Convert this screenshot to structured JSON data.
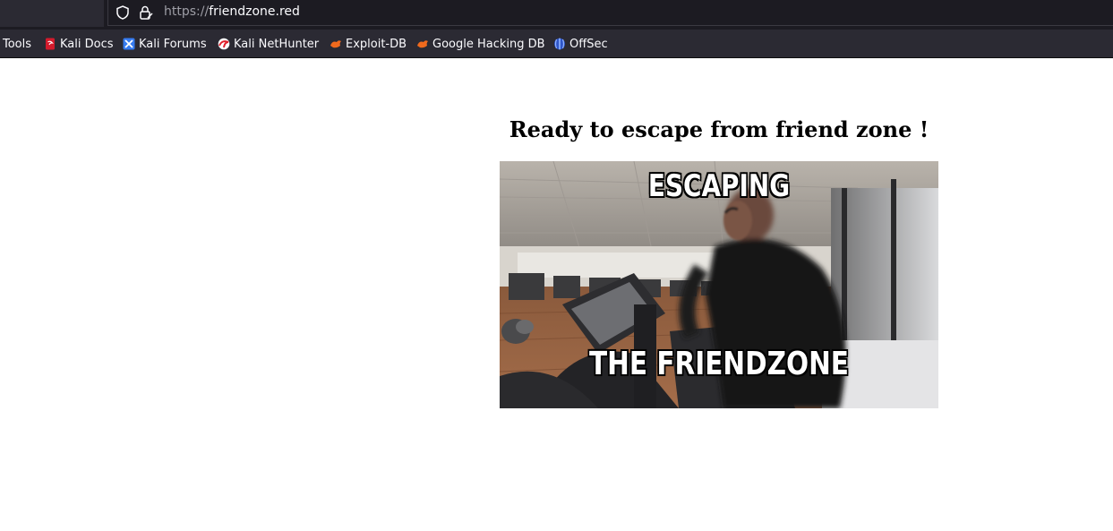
{
  "browser": {
    "url_scheme": "https://",
    "url_host": "friendzone.red",
    "icons": [
      "shield-icon",
      "lock-icon"
    ]
  },
  "bookmarks": [
    {
      "label": "Tools",
      "icon": ""
    },
    {
      "label": "Kali Docs",
      "icon": "kali-docs-icon"
    },
    {
      "label": "Kali Forums",
      "icon": "kali-forums-icon"
    },
    {
      "label": "Kali NetHunter",
      "icon": "kali-nethunter-icon"
    },
    {
      "label": "Exploit-DB",
      "icon": "exploit-db-icon"
    },
    {
      "label": "Google Hacking DB",
      "icon": "exploit-db-icon"
    },
    {
      "label": "OffSec",
      "icon": "offsec-icon"
    }
  ],
  "page": {
    "heading": "Ready to escape from friend zone !",
    "gif": {
      "top_caption": "ESCAPING",
      "bottom_caption": "THE FRIENDZONE"
    }
  },
  "colors": {
    "chrome_dark": "#1c1b22",
    "toolbar": "#2b2a33",
    "text_light": "#fbfbfe"
  }
}
